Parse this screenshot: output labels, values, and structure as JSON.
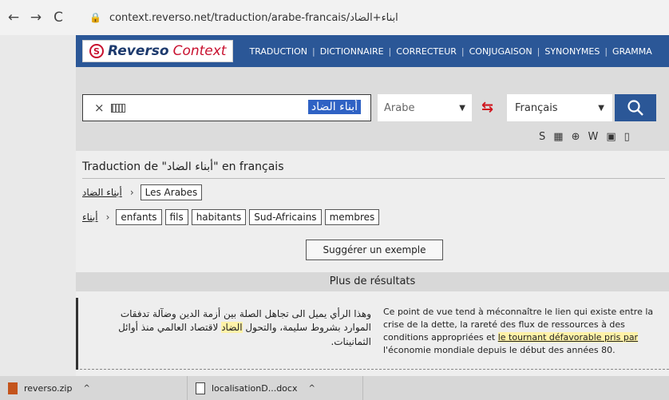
{
  "browser": {
    "back": "←",
    "forward": "→",
    "reload": "C",
    "url": "context.reverso.net/traduction/arabe-francais/ابناء+الضاد"
  },
  "header": {
    "logo_reverso": "Reverso",
    "logo_context": "Context",
    "nav": [
      "TRADUCTION",
      "DICTIONNAIRE",
      "CORRECTEUR",
      "CONJUGAISON",
      "SYNONYMES",
      "GRAMMA"
    ]
  },
  "search": {
    "query": "أبناء الضاد",
    "clear": "×",
    "source_lang": "Arabe",
    "target_lang": "Français",
    "button_icon": "search-icon"
  },
  "dict_icons": [
    "S",
    "▦",
    "⊕",
    "W",
    "▣",
    "▯"
  ],
  "results": {
    "title": "Traduction de \"أبناء الضاد\" en français",
    "row1": {
      "source": "أبناء الضاد",
      "translations": [
        "Les Arabes"
      ]
    },
    "row2": {
      "source": "أبناء",
      "translations": [
        "enfants",
        "fils",
        "habitants",
        "Sud-Africains",
        "membres"
      ]
    },
    "suggest": "Suggérer un exemple",
    "more_results": "Plus de résultats"
  },
  "example": {
    "ar_before": "وهذا الرأي يميل الى تجاهل الصلة بين أزمة الدين وضآلة تدفقات الموارد بشروط سليمة، والتحول ",
    "ar_highlight": "الضاد",
    "ar_after": " لاقتصاد العالمي منذ أوائل الثمانينات.",
    "fr_before": "Ce point de vue tend à méconnaître le lien qui existe entre la crise de la dette, la rareté des flux de ressources à des conditions appropriées et ",
    "fr_highlight": "le tournant défavorable pris par",
    "fr_after": " l'économie mondiale depuis le début des années 80."
  },
  "taskbar": {
    "item1": "reverso.zip",
    "item2": "localisationD...docx"
  },
  "colors": {
    "brand_blue": "#2b5797",
    "brand_red": "#c8102e",
    "highlight": "#fff2a8"
  }
}
